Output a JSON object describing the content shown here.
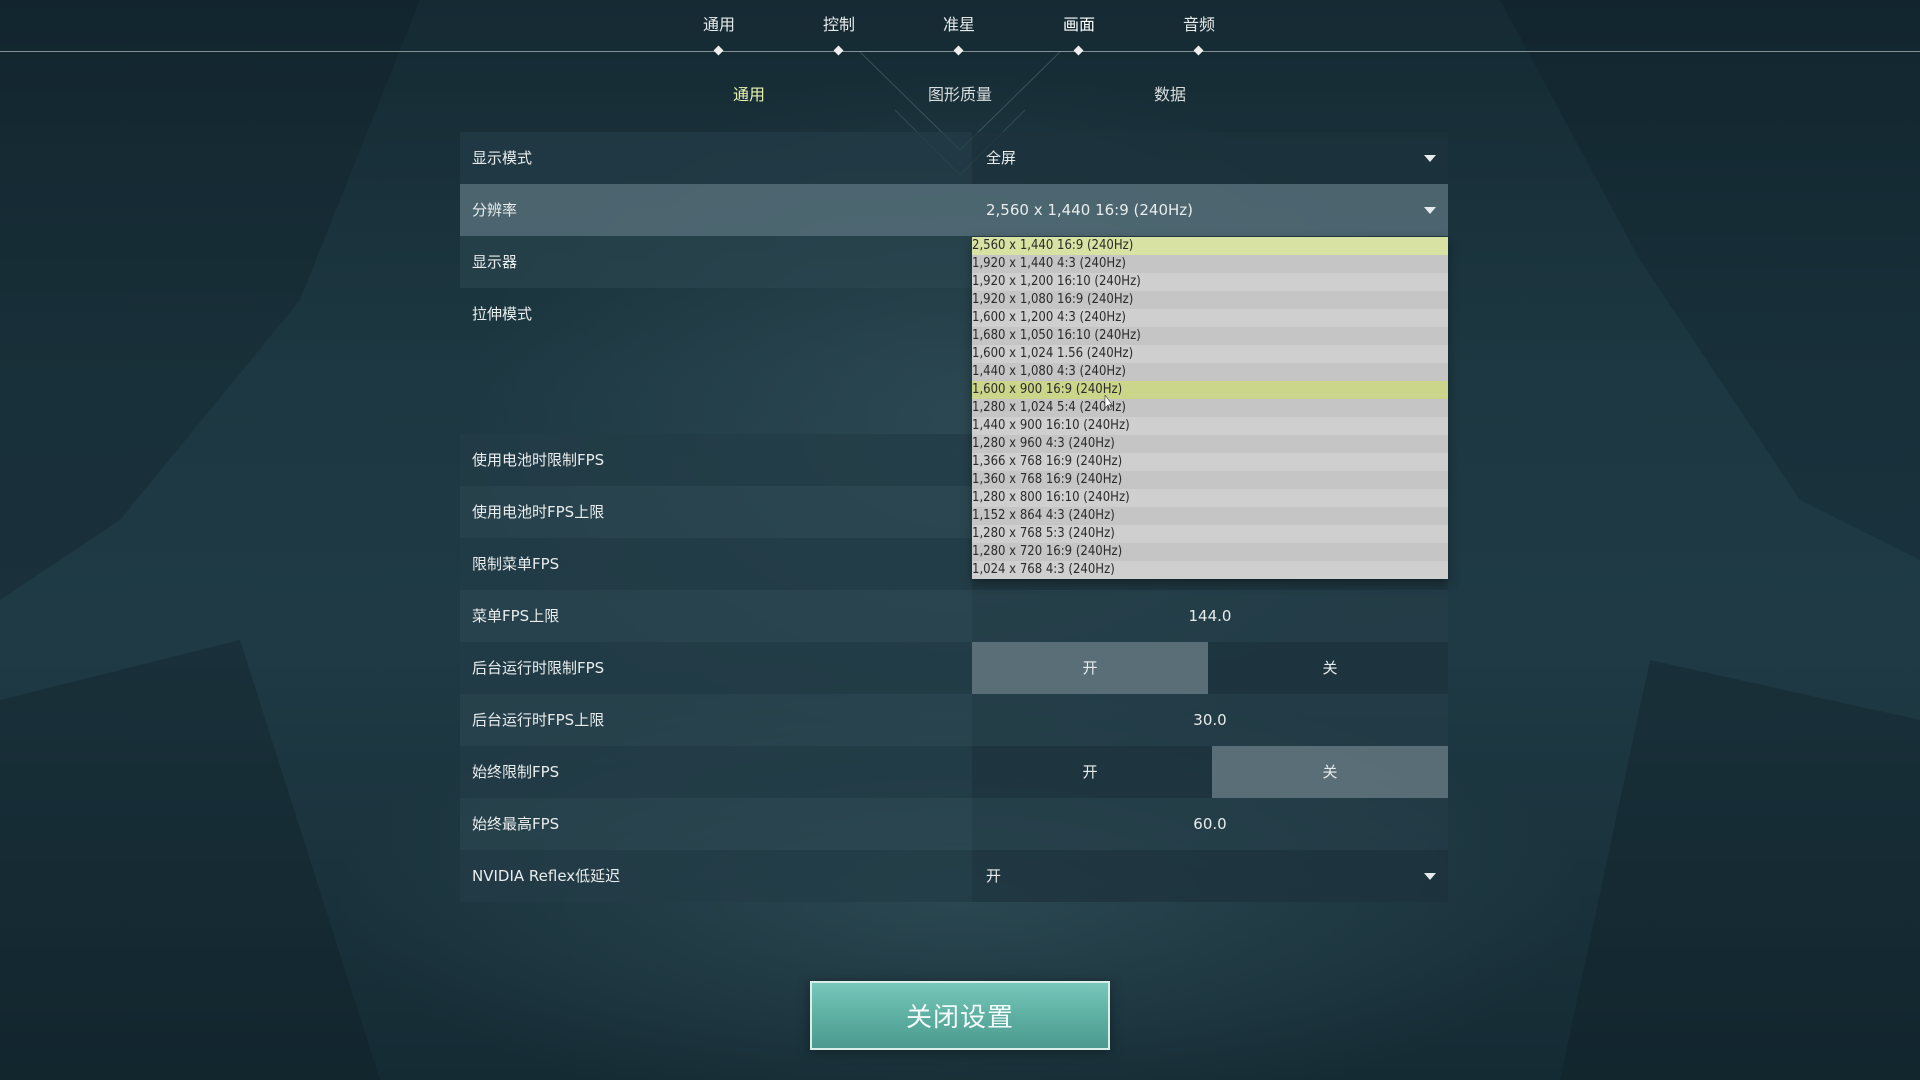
{
  "top_tabs": [
    "通用",
    "控制",
    "准星",
    "画面",
    "音频"
  ],
  "active_top_tab": "画面",
  "sub_tabs": [
    "通用",
    "图形质量",
    "数据"
  ],
  "active_sub_tab": "通用",
  "settings": {
    "display_mode": {
      "label": "显示模式",
      "value": "全屏"
    },
    "resolution": {
      "label": "分辨率",
      "value": "2,560 x 1,440 16:9 (240Hz)"
    },
    "monitor": {
      "label": "显示器"
    },
    "stretch_mode": {
      "label": "拉伸模式"
    },
    "battery_limit_fps": {
      "label": "使用电池时限制FPS"
    },
    "battery_fps_cap": {
      "label": "使用电池时FPS上限"
    },
    "limit_menu_fps": {
      "label": "限制菜单FPS"
    },
    "menu_fps_cap": {
      "label": "菜单FPS上限",
      "value": "144.0"
    },
    "background_limit_fps": {
      "label": "后台运行时限制FPS",
      "on": "开",
      "off": "关",
      "selected": "on"
    },
    "background_fps_cap": {
      "label": "后台运行时FPS上限",
      "value": "30.0"
    },
    "always_limit_fps": {
      "label": "始终限制FPS",
      "on": "开",
      "off": "关",
      "selected": "off"
    },
    "always_max_fps": {
      "label": "始终最高FPS",
      "value": "60.0"
    },
    "nvidia_reflex": {
      "label": "NVIDIA Reflex低延迟",
      "value": "开"
    }
  },
  "resolution_options": [
    "2,560 x 1,440 16:9 (240Hz)",
    "1,920 x 1,440 4:3 (240Hz)",
    "1,920 x 1,200 16:10 (240Hz)",
    "1,920 x 1,080 16:9 (240Hz)",
    "1,600 x 1,200 4:3 (240Hz)",
    "1,680 x 1,050 16:10 (240Hz)",
    "1,600 x 1,024 1.56 (240Hz)",
    "1,440 x 1,080 4:3 (240Hz)",
    "1,600 x 900 16:9 (240Hz)",
    "1,280 x 1,024 5:4 (240Hz)",
    "1,440 x 900 16:10 (240Hz)",
    "1,280 x 960 4:3 (240Hz)",
    "1,366 x 768 16:9 (240Hz)",
    "1,360 x 768 16:9 (240Hz)",
    "1,280 x 800 16:10 (240Hz)",
    "1,152 x 864 4:3 (240Hz)",
    "1,280 x 768 5:3 (240Hz)",
    "1,280 x 720 16:9 (240Hz)",
    "1,024 x 768 4:3 (240Hz)"
  ],
  "selected_resolution_index": 0,
  "hovered_resolution_index": 8,
  "close_button": "关闭设置",
  "colors": {
    "accent_selected": "#d8e2a2",
    "active_subtab": "#e8f2b0",
    "close_button": "#5eb0a3"
  }
}
